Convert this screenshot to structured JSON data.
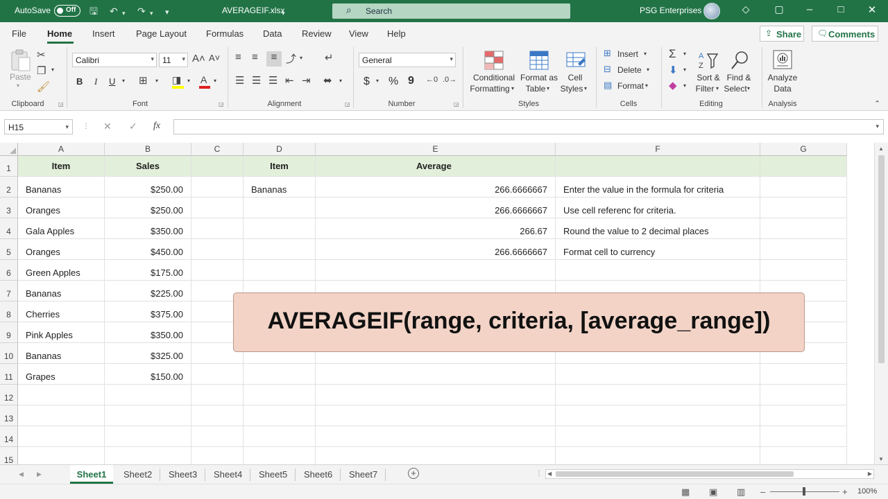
{
  "titlebar": {
    "autosave_label": "AutoSave",
    "autosave_state": "Off",
    "filename": "AVERAGEIF.xlsx",
    "search_placeholder": "Search",
    "user": "PSG Enterprises"
  },
  "ribbon_tabs": [
    "File",
    "Home",
    "Insert",
    "Page Layout",
    "Formulas",
    "Data",
    "Review",
    "View",
    "Help"
  ],
  "active_tab": "Home",
  "share_label": "Share",
  "comments_label": "Comments",
  "clipboard": {
    "paste_label": "Paste",
    "group_label": "Clipboard"
  },
  "font": {
    "name": "Calibri",
    "size": "11",
    "group_label": "Font",
    "bold": "B",
    "italic": "I",
    "underline": "U"
  },
  "alignment": {
    "group_label": "Alignment"
  },
  "number": {
    "format": "General",
    "group_label": "Number",
    "currency": "$",
    "percent": "%",
    "comma": "9"
  },
  "styles": {
    "conditional_l1": "Conditional",
    "conditional_l2": "Formatting",
    "format_table_l1": "Format as",
    "format_table_l2": "Table",
    "cell_styles_l1": "Cell",
    "cell_styles_l2": "Styles",
    "group_label": "Styles"
  },
  "cells": {
    "insert": "Insert",
    "delete": "Delete",
    "format": "Format",
    "group_label": "Cells"
  },
  "editing": {
    "sort_l1": "Sort &",
    "sort_l2": "Filter",
    "find_l1": "Find &",
    "find_l2": "Select",
    "group_label": "Editing"
  },
  "analysis": {
    "analyze_l1": "Analyze",
    "analyze_l2": "Data",
    "group_label": "Analysis"
  },
  "namebox": "H15",
  "formula_value": "",
  "columns": [
    "A",
    "B",
    "C",
    "D",
    "E",
    "F",
    "G"
  ],
  "rows": [
    "1",
    "2",
    "3",
    "4",
    "5",
    "6",
    "7",
    "8",
    "9",
    "10",
    "11",
    "12",
    "13",
    "14",
    "15"
  ],
  "sheet": {
    "header": [
      "Item",
      "Sales",
      "",
      "Item",
      "Average",
      "",
      ""
    ],
    "data": [
      [
        "Bananas",
        "$250.00",
        "",
        "Bananas",
        "266.6666667",
        "Enter the value in the formula for criteria",
        ""
      ],
      [
        "Oranges",
        "$250.00",
        "",
        "",
        "266.6666667",
        "Use cell referenc for criteria.",
        ""
      ],
      [
        "Gala Apples",
        "$350.00",
        "",
        "",
        "266.67",
        "Round the value to 2 decimal places",
        ""
      ],
      [
        "Oranges",
        "$450.00",
        "",
        "",
        "266.6666667",
        "Format cell to currency",
        ""
      ],
      [
        "Green Apples",
        "$175.00",
        "",
        "",
        "",
        "",
        ""
      ],
      [
        "Bananas",
        "$225.00",
        "",
        "",
        "",
        "",
        ""
      ],
      [
        "Cherries",
        "$375.00",
        "",
        "",
        "",
        "",
        ""
      ],
      [
        "Pink Apples",
        "$350.00",
        "",
        "",
        "",
        "",
        ""
      ],
      [
        "Bananas",
        "$325.00",
        "",
        "",
        "",
        "",
        ""
      ],
      [
        "Grapes",
        "$150.00",
        "",
        "",
        "",
        "",
        ""
      ],
      [
        "",
        "",
        "",
        "",
        "",
        "",
        ""
      ],
      [
        "",
        "",
        "",
        "",
        "",
        "",
        ""
      ],
      [
        "",
        "",
        "",
        "",
        "",
        "",
        ""
      ],
      [
        "",
        "",
        "",
        "",
        "",
        "",
        ""
      ]
    ]
  },
  "overlay_text": "AVERAGEIF(range, criteria, [average_range])",
  "sheet_tabs": [
    "Sheet1",
    "Sheet2",
    "Sheet3",
    "Sheet4",
    "Sheet5",
    "Sheet6",
    "Sheet7"
  ],
  "active_sheet": "Sheet1",
  "zoom": "100%",
  "accent_color": "#217346"
}
